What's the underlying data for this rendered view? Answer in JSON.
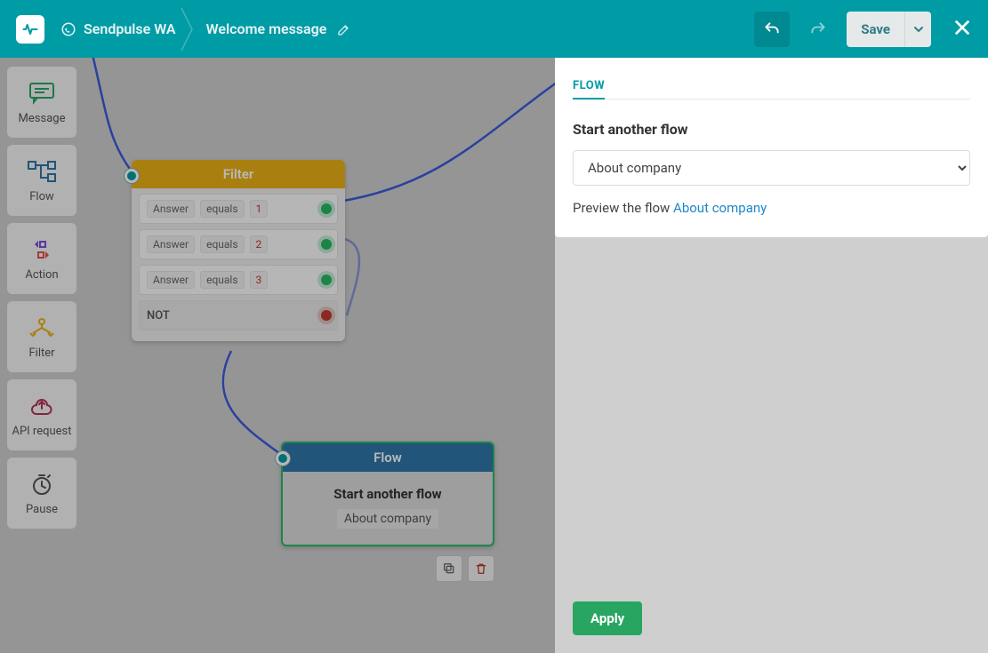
{
  "header": {
    "bot_name": "Sendpulse WA",
    "flow_title": "Welcome message",
    "save_label": "Save"
  },
  "toolbar": [
    {
      "id": "message",
      "label": "Message"
    },
    {
      "id": "flow",
      "label": "Flow"
    },
    {
      "id": "action",
      "label": "Action"
    },
    {
      "id": "filter",
      "label": "Filter"
    },
    {
      "id": "api",
      "label": "API request"
    },
    {
      "id": "pause",
      "label": "Pause"
    }
  ],
  "filter_node": {
    "title": "Filter",
    "conditions": [
      {
        "field": "Answer",
        "op": "equals",
        "value": "1"
      },
      {
        "field": "Answer",
        "op": "equals",
        "value": "2"
      },
      {
        "field": "Answer",
        "op": "equals",
        "value": "3"
      }
    ],
    "not_label": "NOT"
  },
  "flow_node": {
    "title": "Flow",
    "heading": "Start another flow",
    "selected": "About company"
  },
  "panel": {
    "tab": "FLOW",
    "label": "Start another flow",
    "selected_option": "About company",
    "preview_prefix": "Preview the flow ",
    "preview_link": "About company",
    "apply_label": "Apply"
  }
}
